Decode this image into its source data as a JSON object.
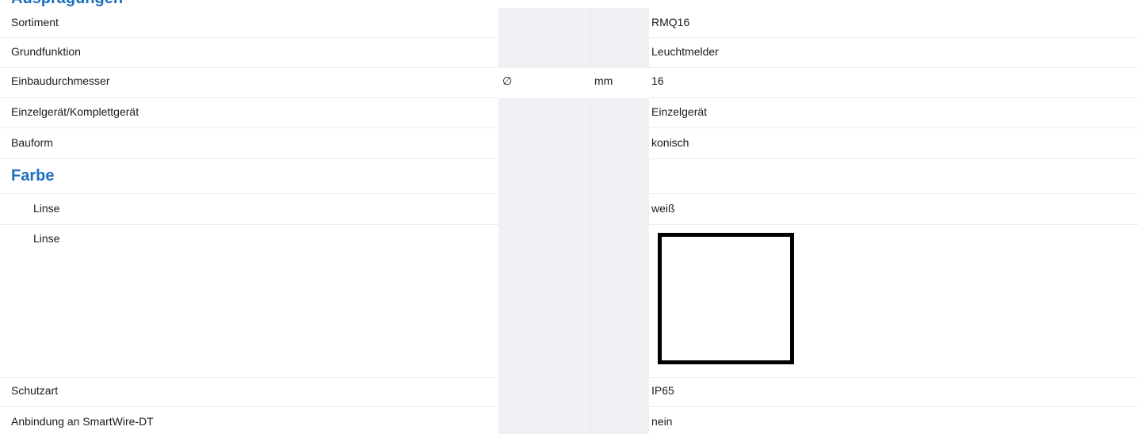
{
  "section_top_partial": "Ausprägungen",
  "rows": [
    {
      "label": "Sortiment",
      "value": "RMQ16"
    },
    {
      "label": "Grundfunktion",
      "value": "Leuchtmelder"
    },
    {
      "label": "Einbaudurchmesser",
      "unit_symbol": "∅",
      "unit": "mm",
      "value": "16"
    },
    {
      "label": "Einzelgerät/Komplettgerät",
      "value": "Einzelgerät"
    },
    {
      "label": "Bauform",
      "value": "konisch"
    }
  ],
  "section_farbe": "Farbe",
  "farbe_rows": [
    {
      "label": "Linse",
      "value": "weiß"
    },
    {
      "label": "Linse",
      "swatch_color": "#ffffff"
    }
  ],
  "rows_after": [
    {
      "label": "Schutzart",
      "value": "IP65"
    },
    {
      "label": "Anbindung an SmartWire-DT",
      "value": "nein"
    }
  ],
  "colors": {
    "accent": "#1d6fbf",
    "unit_column_bg": "#f0f1f4",
    "swatch_border": "#000000"
  }
}
